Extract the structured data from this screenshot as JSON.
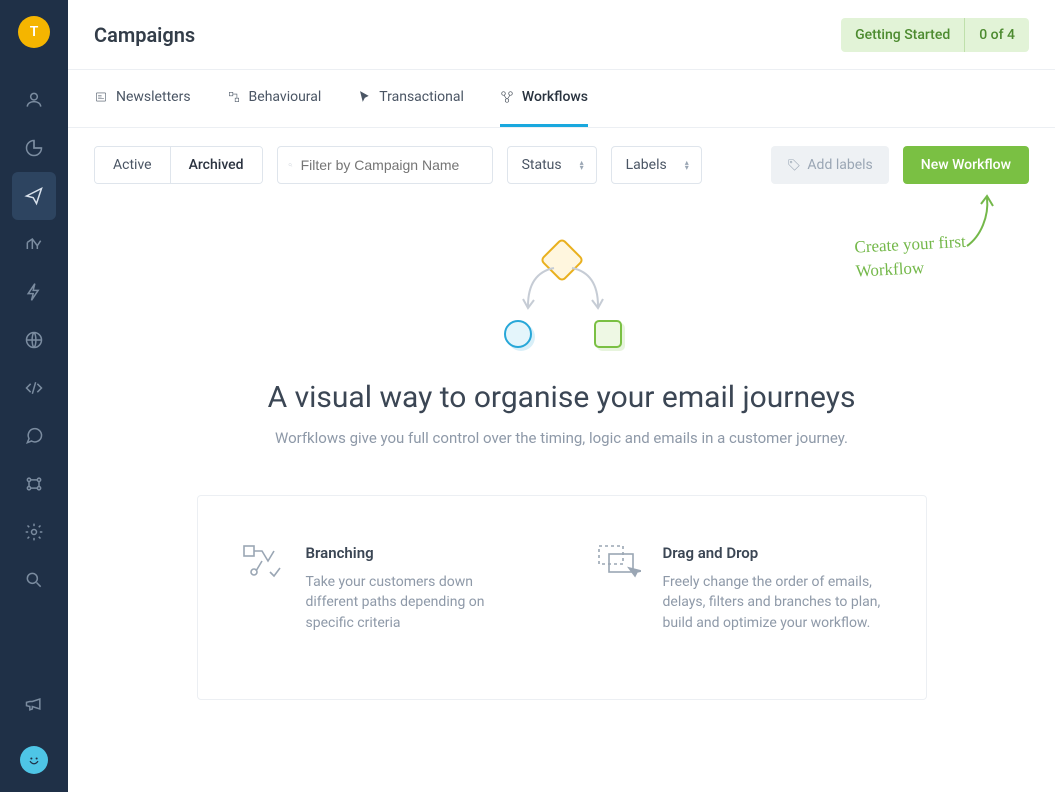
{
  "avatar_initial": "T",
  "page_title": "Campaigns",
  "getting_started": {
    "label": "Getting Started",
    "progress": "0 of 4"
  },
  "tabs": {
    "newsletters": "Newsletters",
    "behavioural": "Behavioural",
    "transactional": "Transactional",
    "workflows": "Workflows"
  },
  "segmented": {
    "active": "Active",
    "archived": "Archived"
  },
  "filter_placeholder": "Filter by Campaign Name",
  "status_dd": "Status",
  "labels_dd": "Labels",
  "add_labels_btn": "Add labels",
  "new_workflow_btn": "New Workflow",
  "handwrite_line1": "Create your first",
  "handwrite_line2": "Workflow",
  "empty_heading": "A visual way to organise your email journeys",
  "empty_sub": "Worfklows give you full control over the timing, logic and emails in a customer journey.",
  "feature1_title": "Branching",
  "feature1_desc": "Take your customers down different paths depending on specific criteria",
  "feature2_title": "Drag and Drop",
  "feature2_desc": "Freely change the order of emails, delays, filters and branches to plan, build and optimize your workflow."
}
